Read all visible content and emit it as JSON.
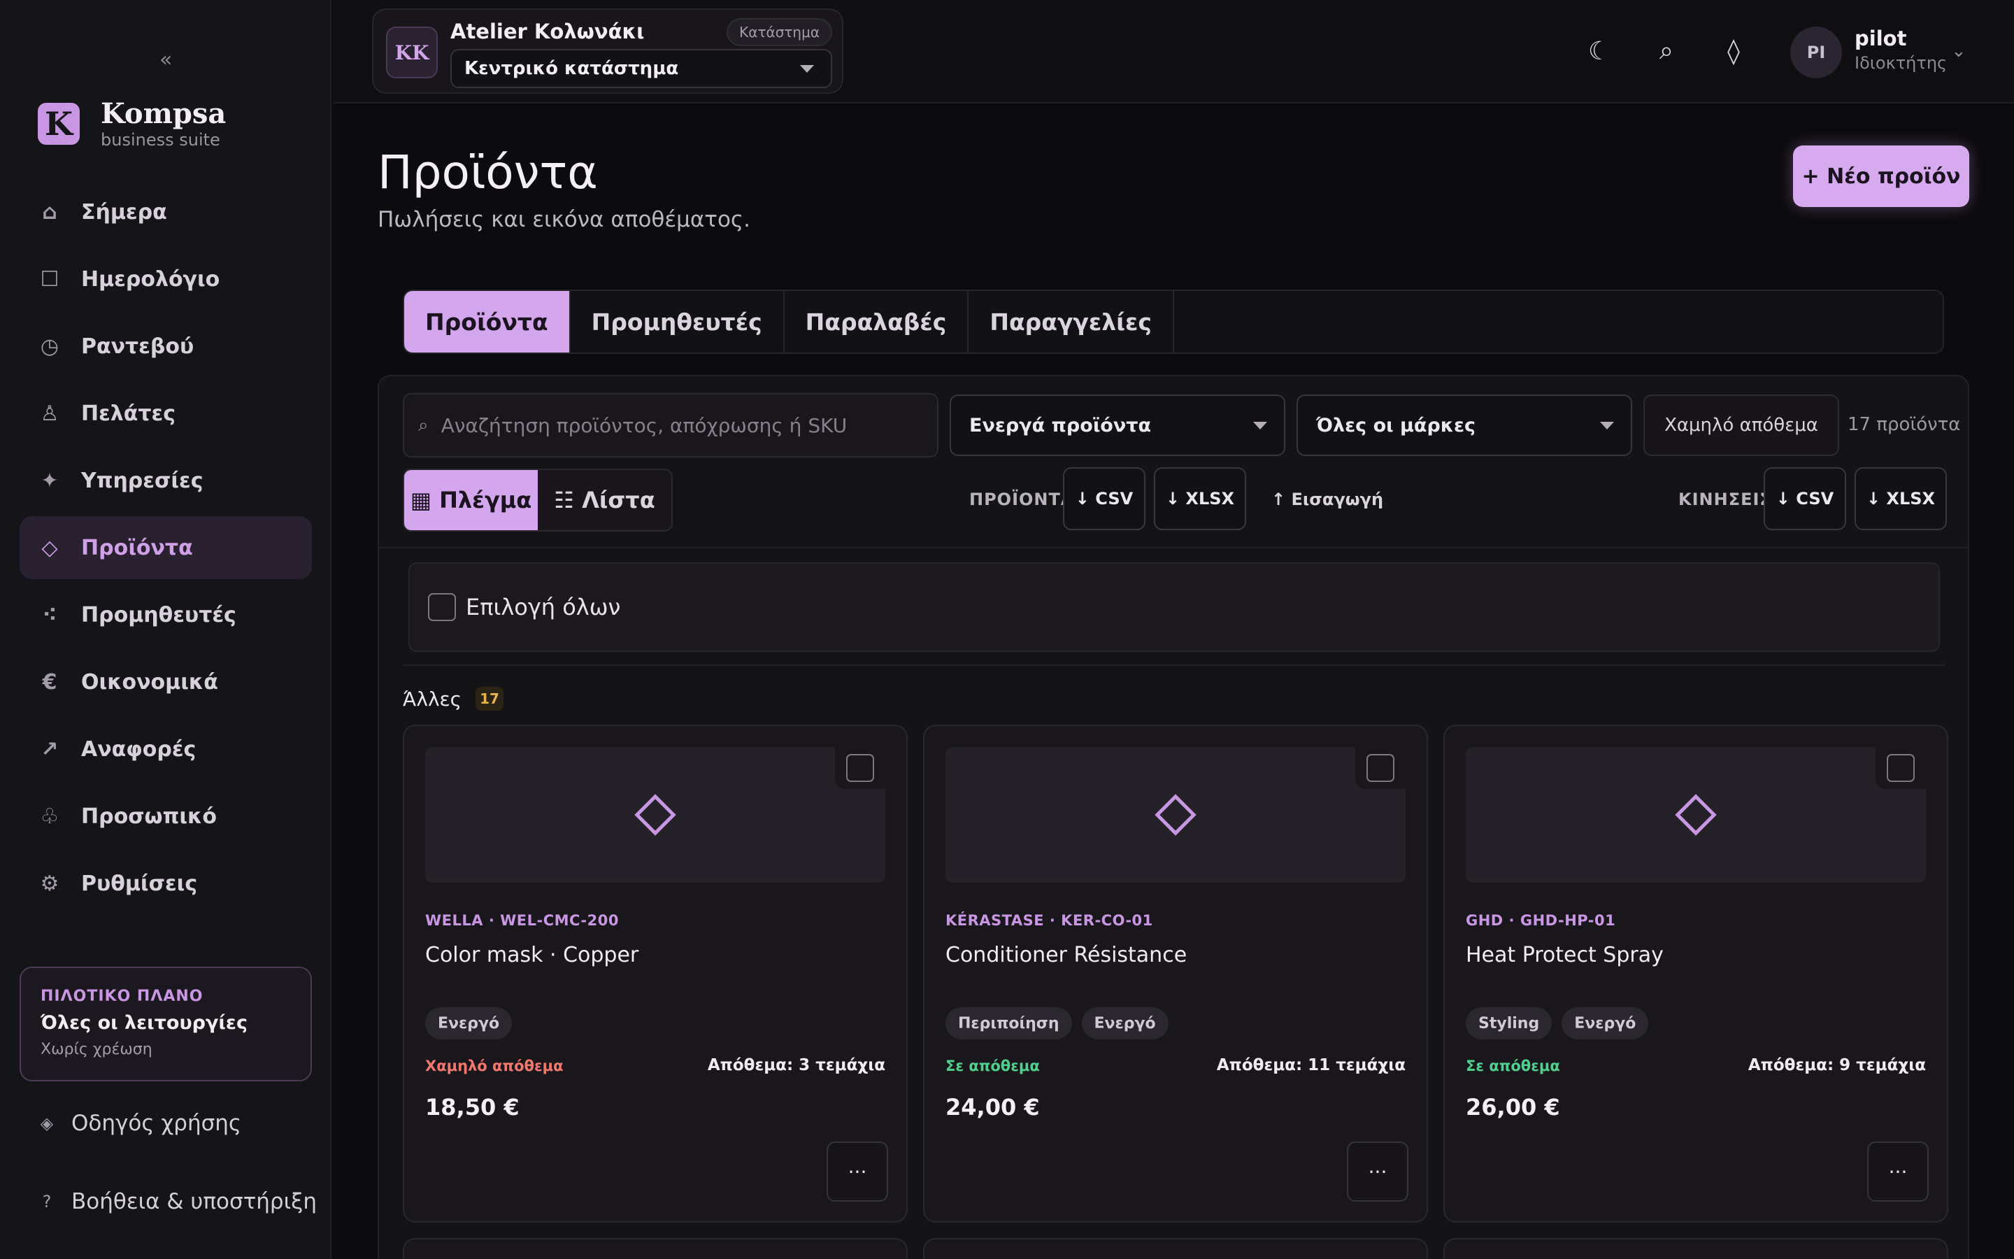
{
  "sidebar": {
    "collapse": "«",
    "brand": {
      "logo": "K",
      "name": "Kompsa",
      "sub": "business suite"
    },
    "items": [
      {
        "label": "Σήμερα",
        "icon": "⌂",
        "icon_name": "home-icon"
      },
      {
        "label": "Ημερολόγιο",
        "icon": "☐",
        "icon_name": "calendar-icon"
      },
      {
        "label": "Ραντεβού",
        "icon": "◷",
        "icon_name": "clock-icon"
      },
      {
        "label": "Πελάτες",
        "icon": "♙",
        "icon_name": "person-icon"
      },
      {
        "label": "Υπηρεσίες",
        "icon": "✦",
        "icon_name": "sparkle-icon"
      },
      {
        "label": "Προϊόντα",
        "icon": "◇",
        "icon_name": "diamond-icon",
        "active": true
      },
      {
        "label": "Προμηθευτές",
        "icon": "⁖",
        "icon_name": "dots-icon"
      },
      {
        "label": "Οικονομικά",
        "icon": "€",
        "icon_name": "euro-icon"
      },
      {
        "label": "Αναφορές",
        "icon": "↗",
        "icon_name": "trend-icon"
      },
      {
        "label": "Προσωπικό",
        "icon": "♧",
        "icon_name": "staff-icon"
      },
      {
        "label": "Ρυθμίσεις",
        "icon": "⚙",
        "icon_name": "gear-icon"
      }
    ],
    "plan": {
      "tag": "ΠΙΛΟΤΙΚΟ ΠΛΑΝΟ",
      "title": "Όλες οι λειτουργίες",
      "sub": "Χωρίς χρέωση"
    },
    "guide": {
      "icon": "◈",
      "label": "Οδηγός χρήσης"
    },
    "help": {
      "icon": "?",
      "label": "Βοήθεια & υποστήριξη"
    }
  },
  "topbar": {
    "store": {
      "avatar": "KK",
      "name": "Atelier Κολωνάκι",
      "badge": "Κατάστημα",
      "selected": "Κεντρικό κατάστημα"
    },
    "icons": {
      "theme": "☾",
      "search": "⌕",
      "diamond": "◊"
    },
    "user": {
      "initials": "PI",
      "name": "pilot",
      "role": "Ιδιοκτήτης",
      "chevron": "⌄"
    }
  },
  "page": {
    "title": "Προϊόντα",
    "subtitle": "Πωλήσεις και εικόνα αποθέματος.",
    "new_button": "+ Νέο προϊόν"
  },
  "tabs": [
    "Προϊόντα",
    "Προμηθευτές",
    "Παραλαβές",
    "Παραγγελίες"
  ],
  "filters": {
    "search_icon": "⌕",
    "search_placeholder": "Αναζήτηση προϊόντος, απόχρωσης ή SKU",
    "status": "Ενεργά προϊόντα",
    "brand": "Όλες οι μάρκες",
    "low_stock": "Χαμηλό απόθεμα",
    "count": "17 προϊόντα"
  },
  "view": {
    "grid": "▦ Πλέγμα",
    "list": "☷ Λίστα"
  },
  "export": {
    "products_label": "ΠΡΟΪΟΝΤΑ",
    "products_csv": "↓ CSV",
    "products_xlsx": "↓ XLSX",
    "import": "↑ Εισαγωγή",
    "movements_label": "ΚΙΝΗΣΕΙΣ",
    "movements_csv": "↓ CSV",
    "movements_xlsx": "↓ XLSX"
  },
  "select_all": "Επιλογή όλων",
  "section": {
    "label": "Άλλες",
    "count": "17"
  },
  "products": [
    {
      "meta": "WELLA · WEL-CMC-200",
      "name": "Color mask · Copper",
      "tags": [
        "Ενεργό"
      ],
      "stock_state": "Χαμηλό απόθεμα",
      "stock_kind": "low",
      "stock_qty": "Απόθεμα: 3 τεμάχια",
      "price": "18,50 €",
      "more": "···"
    },
    {
      "meta": "KÉRASTASE · KER-CO-01",
      "name": "Conditioner Résistance",
      "tags": [
        "Περιποίηση",
        "Ενεργό"
      ],
      "stock_state": "Σε απόθεμα",
      "stock_kind": "ok",
      "stock_qty": "Απόθεμα: 11 τεμάχια",
      "price": "24,00 €",
      "more": "···"
    },
    {
      "meta": "GHD · GHD-HP-01",
      "name": "Heat Protect Spray",
      "tags": [
        "Styling",
        "Ενεργό"
      ],
      "stock_state": "Σε απόθεμα",
      "stock_kind": "ok",
      "stock_qty": "Απόθεμα: 9 τεμάχια",
      "price": "26,00 €",
      "more": "···"
    }
  ],
  "colors": {
    "accent": "#c996e3",
    "low": "#f2786d",
    "ok": "#4fce8d",
    "background": "#0c0b0e"
  }
}
